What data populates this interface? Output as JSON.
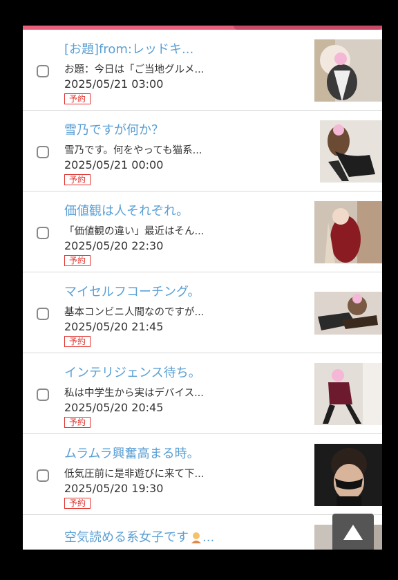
{
  "posts": [
    {
      "title": "[お題]from:レッドキ...",
      "excerpt": "お題：今日は「ご当地グルメ...",
      "date": "2025/05/21 03:00",
      "badge": "予約"
    },
    {
      "title": "雪乃ですが何か？",
      "excerpt": "雪乃です。何をやっても猫系...",
      "date": "2025/05/21 00:00",
      "badge": "予約"
    },
    {
      "title": "価値観は人それぞれ。",
      "excerpt": "「価値観の違い」最近はそん...",
      "date": "2025/05/20 22:30",
      "badge": "予約"
    },
    {
      "title": "マイセルフコーチング。",
      "excerpt": "基本コンビニ人間なのですが...",
      "date": "2025/05/20 21:45",
      "badge": "予約"
    },
    {
      "title": "インテリジェンス待ち。",
      "excerpt": "私は中学生から実はデバイス...",
      "date": "2025/05/20 20:45",
      "badge": "予約"
    },
    {
      "title": "ムラムラ興奮高まる時。",
      "excerpt": "低気圧前に是非遊びに来て下...",
      "date": "2025/05/20 19:30",
      "badge": "予約"
    }
  ],
  "partial_post": {
    "title": "空気読める系女子です",
    "title_suffix": "..."
  },
  "scroll_top_icon": "arrow-up-icon",
  "colors": {
    "accent": "#e8607c",
    "title_link": "#5a9fd4",
    "badge_red": "#e0322d"
  }
}
